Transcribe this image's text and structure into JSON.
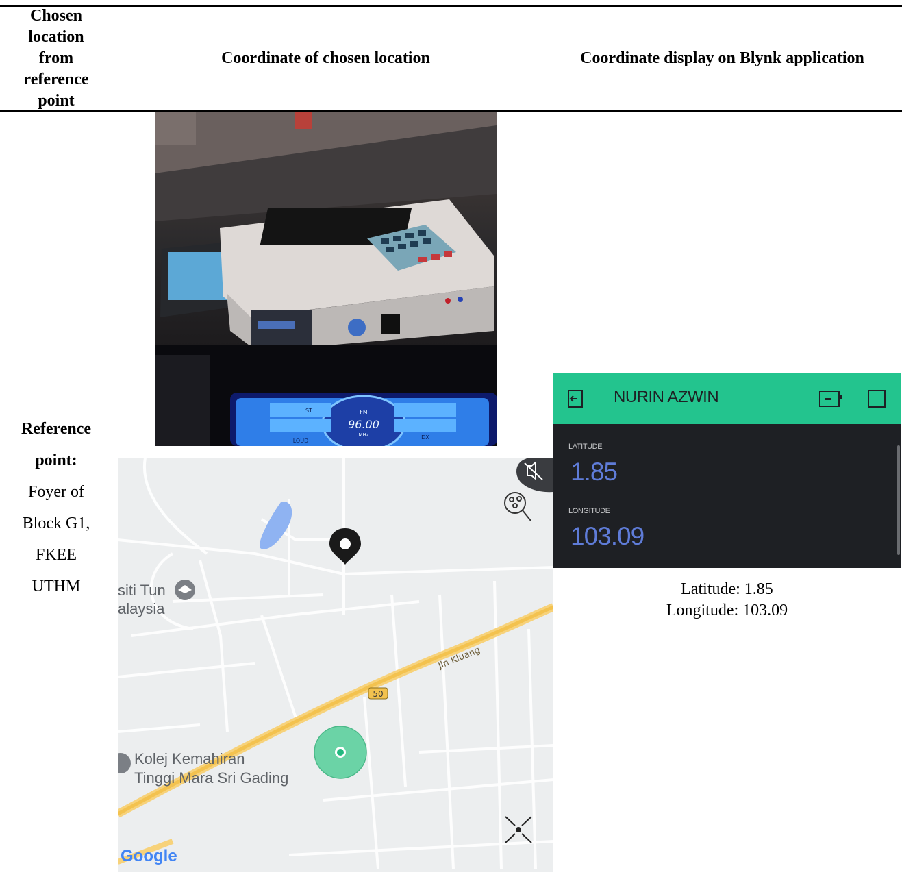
{
  "table": {
    "headers": [
      "Chosen location from reference point",
      "Coordinate of chosen location",
      "Coordinate display on Blynk application"
    ],
    "row": {
      "reference_bold": "Reference point:",
      "reference_text": [
        "Foyer of",
        "Block G1,",
        "FKEE",
        "UTHM"
      ]
    }
  },
  "photo": {
    "radio_display": "96.00",
    "radio_band": "FM",
    "radio_unit": "MHz",
    "radio_buttons": [
      "ST",
      "LOUD",
      "DX"
    ]
  },
  "map": {
    "labels": {
      "university": "siti Tun\nalaysia",
      "road": "Jln Kluang",
      "route": "50",
      "college": "Kolej Kemahiran\nTinggi Mara Sri Gading",
      "brand": "Google"
    },
    "icons": [
      "mute-icon",
      "location-search-icon",
      "map-pin-icon",
      "current-location-icon",
      "collapse-icon"
    ]
  },
  "blynk": {
    "title": "NURIN AZWIN",
    "latitude_label": "LATITUDE",
    "latitude_value": "1.85",
    "longitude_label": "LONGITUDE",
    "longitude_value": "103.09",
    "accent_color": "#23c48e",
    "value_color": "#5f7cd8"
  },
  "caption": {
    "latitude": "Latitude: 1.85",
    "longitude": "Longitude: 103.09"
  }
}
